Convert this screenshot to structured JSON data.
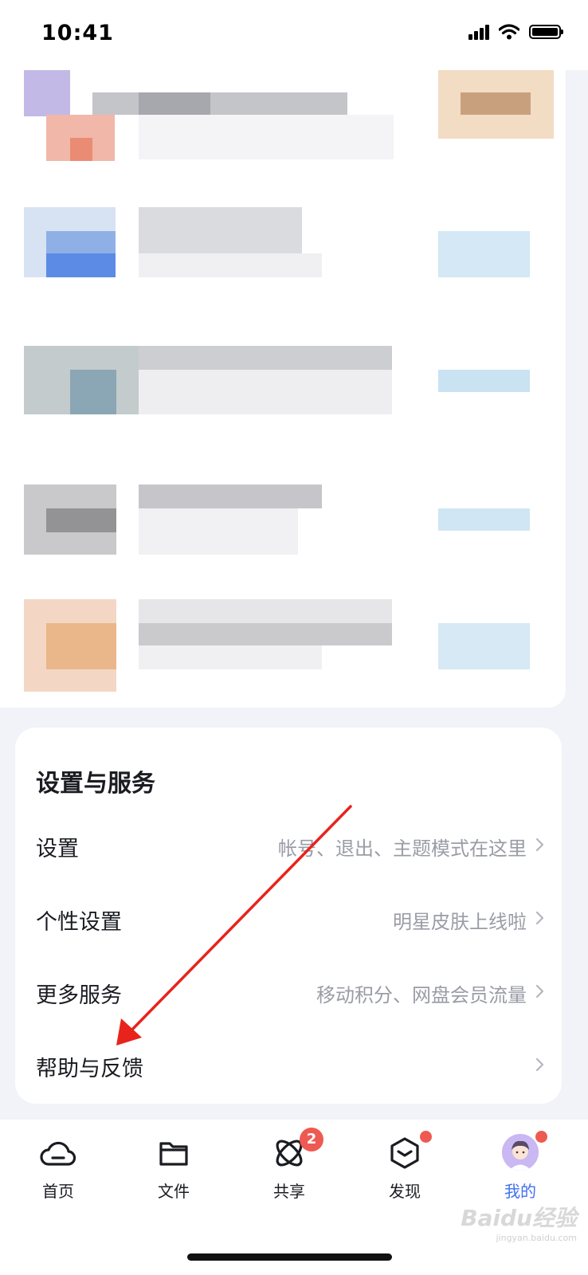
{
  "status_bar": {
    "time": "10:41"
  },
  "settings": {
    "title": "设置与服务",
    "rows": [
      {
        "label": "设置",
        "desc": "帐号、退出、主题模式在这里"
      },
      {
        "label": "个性设置",
        "desc": "明星皮肤上线啦"
      },
      {
        "label": "更多服务",
        "desc": "移动积分、网盘会员流量"
      },
      {
        "label": "帮助与反馈",
        "desc": ""
      }
    ]
  },
  "bottom_nav": {
    "items": [
      {
        "label": "首页",
        "icon": "cloud-icon"
      },
      {
        "label": "文件",
        "icon": "folder-icon"
      },
      {
        "label": "共享",
        "icon": "share-orbit-icon",
        "badge": "2"
      },
      {
        "label": "发现",
        "icon": "discover-cube-icon",
        "dot": true
      },
      {
        "label": "我的",
        "icon": "avatar",
        "dot": true,
        "active": true
      }
    ]
  },
  "watermark": {
    "brand": "Baidu经验",
    "url": "jingyan.baidu.com"
  },
  "colors": {
    "accent": "#4170f0",
    "badge": "#ee5a52",
    "arrow": "#e8231c"
  }
}
